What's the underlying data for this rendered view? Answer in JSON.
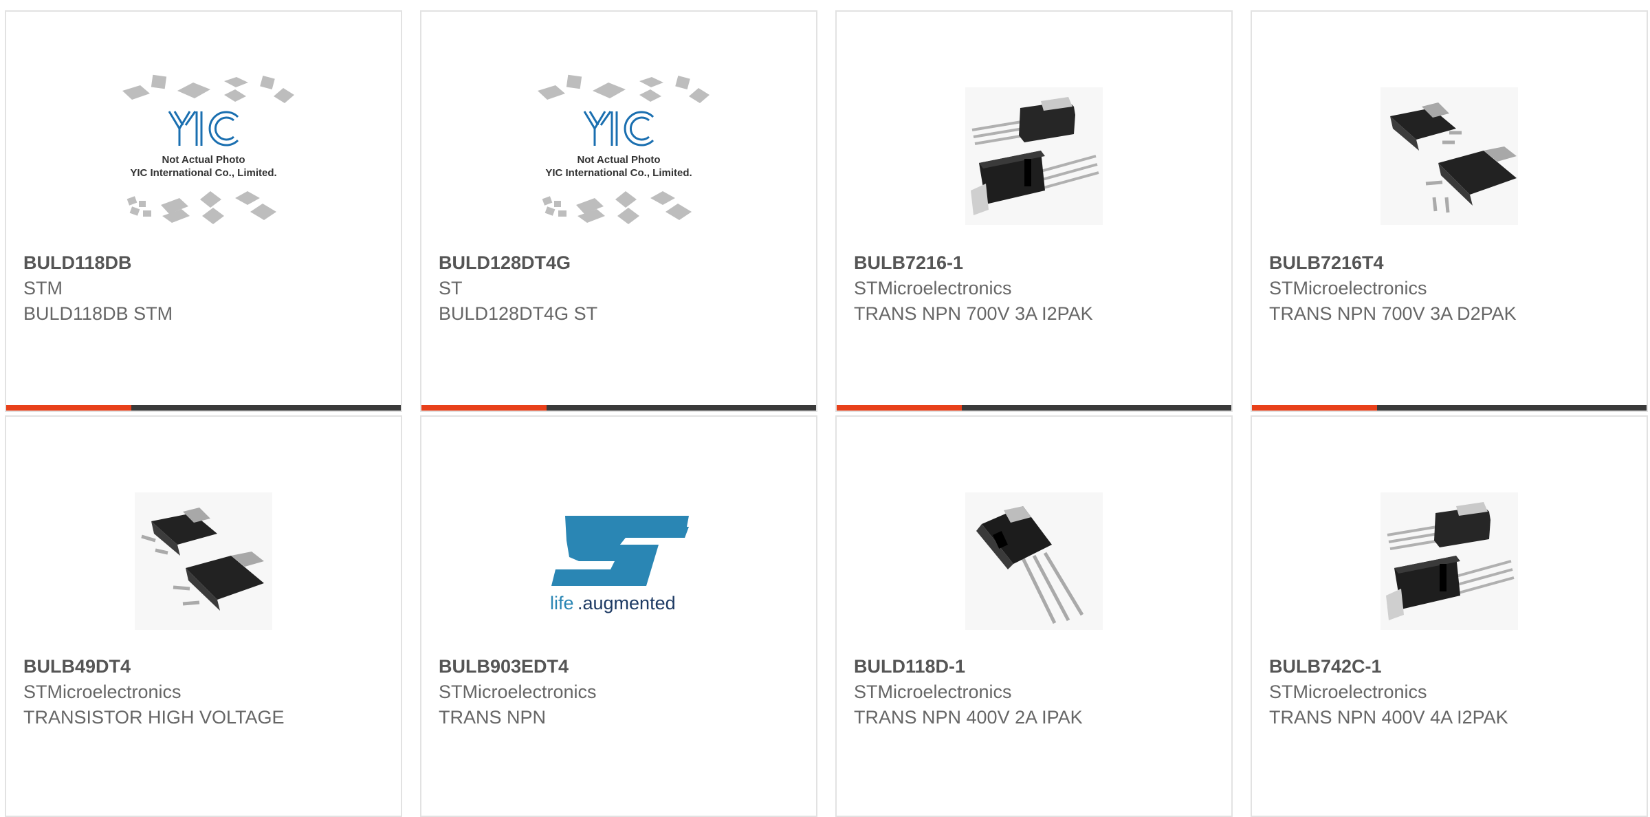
{
  "colors": {
    "accent": "#e8401a",
    "bar": "#3a3a3a",
    "border": "#e2e2e2",
    "st_blue": "#2a86b4"
  },
  "products": [
    {
      "part_number": "BULD118DB",
      "manufacturer": "STM",
      "description": "BULD118DB STM",
      "image": "placeholder-photo",
      "placeholder_title": "Not Actual Photo",
      "placeholder_subtitle": "YIC International Co., Limited.",
      "logo_text": "YIC"
    },
    {
      "part_number": "BULD128DT4G",
      "manufacturer": "ST",
      "description": "BULD128DT4G ST",
      "image": "placeholder-photo",
      "placeholder_title": "Not Actual Photo",
      "placeholder_subtitle": "YIC International Co., Limited.",
      "logo_text": "YIC"
    },
    {
      "part_number": "BULB7216-1",
      "manufacturer": "STMicroelectronics",
      "description": "TRANS NPN 700V 3A I2PAK",
      "image": "i2pak-package"
    },
    {
      "part_number": "BULB7216T4",
      "manufacturer": "STMicroelectronics",
      "description": "TRANS NPN 700V 3A D2PAK",
      "image": "d2pak-package"
    },
    {
      "part_number": "BULB49DT4",
      "manufacturer": "STMicroelectronics",
      "description": "TRANSISTOR HIGH VOLTAGE",
      "image": "d2pak-package"
    },
    {
      "part_number": "BULB903EDT4",
      "manufacturer": "STMicroelectronics",
      "description": "TRANS NPN",
      "image": "st-logo",
      "logo_tagline_1": "life",
      "logo_tagline_2": ".augmented"
    },
    {
      "part_number": "BULD118D-1",
      "manufacturer": "STMicroelectronics",
      "description": "TRANS NPN 400V 2A IPAK",
      "image": "ipak-package"
    },
    {
      "part_number": "BULB742C-1",
      "manufacturer": "STMicroelectronics",
      "description": "TRANS NPN 400V 4A I2PAK",
      "image": "i2pak-package"
    }
  ]
}
